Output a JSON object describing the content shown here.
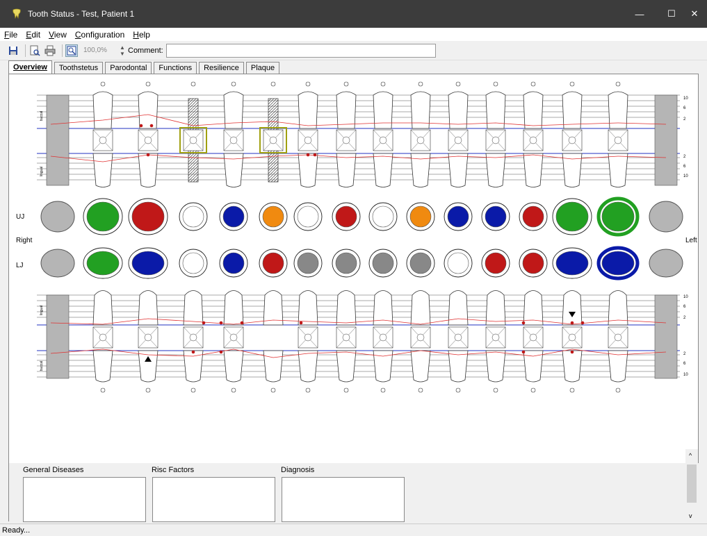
{
  "window": {
    "title": "Tooth Status - Test, Patient 1",
    "minimize": "—",
    "maximize": "☐",
    "close": "✕"
  },
  "menu": [
    {
      "label": "File",
      "ul": "F",
      "rest": "ile"
    },
    {
      "label": "Edit",
      "ul": "E",
      "rest": "dit"
    },
    {
      "label": "View",
      "ul": "V",
      "rest": "iew"
    },
    {
      "label": "Configuration",
      "ul": "C",
      "rest": "onfiguration"
    },
    {
      "label": "Help",
      "ul": "H",
      "rest": "elp"
    }
  ],
  "toolbar": {
    "zoom": "100,0%",
    "comment_label": "Comment:",
    "comment_value": ""
  },
  "tabs": [
    "Overview",
    "Toothstetus",
    "Parodontal",
    "Functions",
    "Resilience",
    "Plaque"
  ],
  "side": {
    "right": "Right",
    "left": "Left",
    "uj": "UJ",
    "lj": "LJ",
    "buccal": "buccal",
    "lingual": "lingual"
  },
  "scale_ticks": [
    "10",
    "6",
    "2",
    "2",
    "6",
    "10"
  ],
  "bottom": {
    "general_diseases": "General Diseases",
    "risc_factors": "Risc Factors",
    "diagnosis": "Diagnosis"
  },
  "status": "Ready...",
  "colors": {
    "titlebar": "#3c3c3c",
    "green": "#22a022",
    "red": "#c01818",
    "blue": "#0a1aa8",
    "orange": "#f08a10",
    "gray": "#b5b5b5"
  }
}
